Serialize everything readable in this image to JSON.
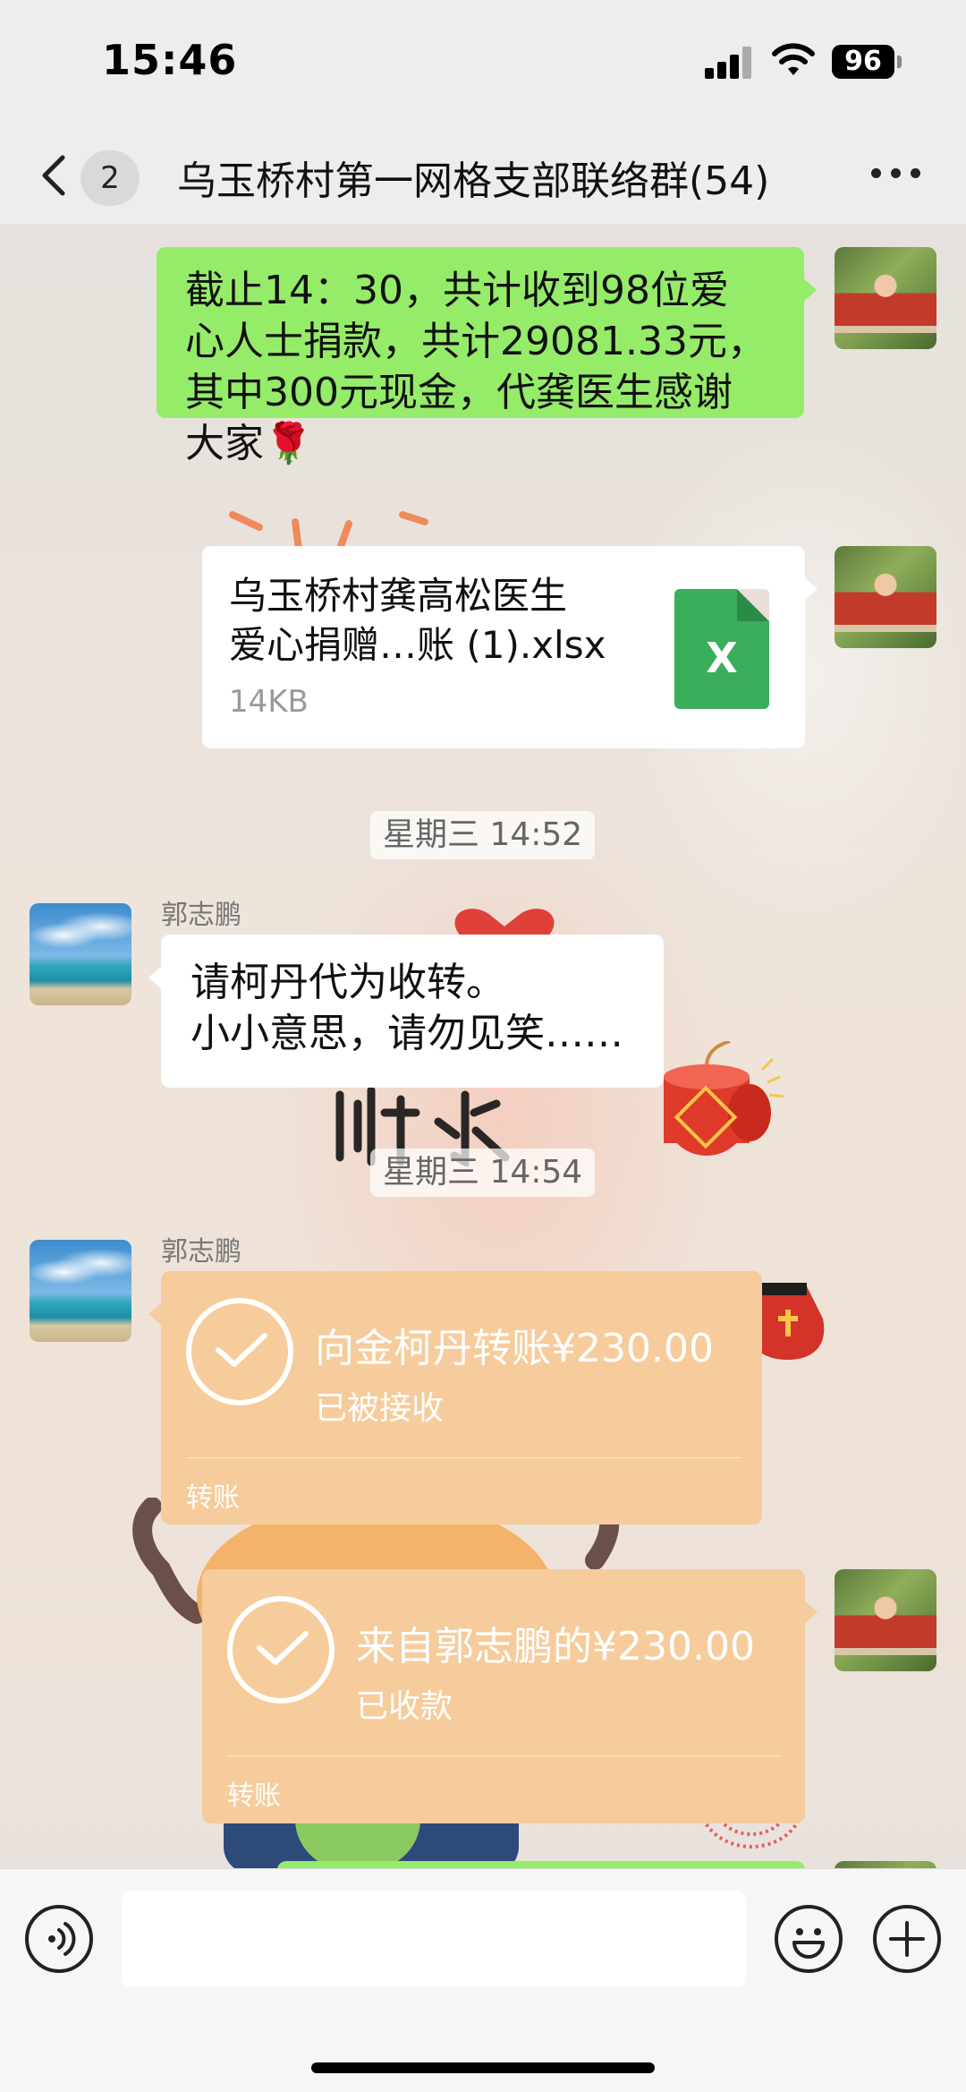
{
  "status_bar": {
    "time": "15:46",
    "battery": "96"
  },
  "nav": {
    "unread_count": "2",
    "title": "乌玉桥村第一网格支部联络群(54)"
  },
  "messages": {
    "msg1": {
      "text": "截止14：30，共计收到98位爱\n心人士捐款，共计29081.33元，\n其中300元现金，代龚医生感谢\n大家🌹"
    },
    "file": {
      "name": "乌玉桥村龚高松医生\n爱心捐赠…账 (1).xlsx",
      "size": "14KB",
      "icon_letter": "X"
    },
    "timestamp1": "星期三 14:52",
    "msg2": {
      "sender": "郭志鹏",
      "text": "请柯丹代为收转。\n小小意思，请勿见笑……"
    },
    "timestamp2": "星期三 14:54",
    "transfer1": {
      "sender": "郭志鹏",
      "title": "向金柯丹转账¥230.00",
      "status": "已被接收",
      "type": "转账"
    },
    "transfer2": {
      "title": "来自郭志鹏的¥230.00",
      "status": "已收款",
      "type": "转账"
    }
  },
  "input": {
    "placeholder": ""
  },
  "icons": {
    "back": "chevron-left-icon",
    "more": "more-icon",
    "voice": "voice-icon",
    "emoji": "emoji-icon",
    "add": "plus-icon",
    "file": "excel-file-icon",
    "check": "check-circle-icon"
  },
  "colors": {
    "bubble_green": "#95ec69",
    "bubble_white": "#ffffff",
    "transfer": "#f6cc9c",
    "file_icon": "#3bae5c"
  }
}
